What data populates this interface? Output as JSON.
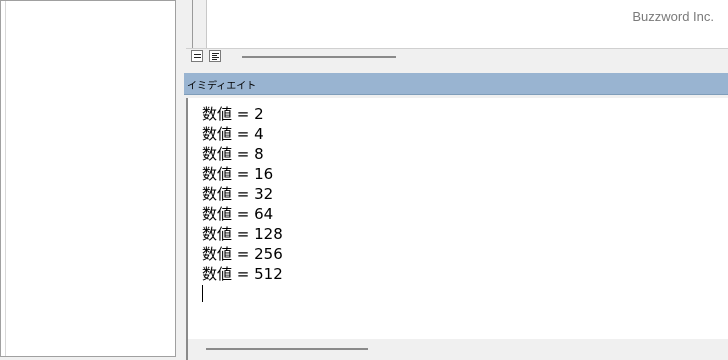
{
  "watermark": "Buzzword Inc.",
  "immediate_window": {
    "title": "イミディエイト",
    "output_lines": [
      "数値 = 2",
      "数値 = 4",
      "数値 = 8",
      "数値 = 16",
      "数値 = 32",
      "数値 = 64",
      "数値 = 128",
      "数値 = 256",
      "数値 = 512"
    ]
  },
  "icons": {
    "procedure_view": "procedure-view-icon",
    "full_module_view": "full-module-view-icon"
  }
}
